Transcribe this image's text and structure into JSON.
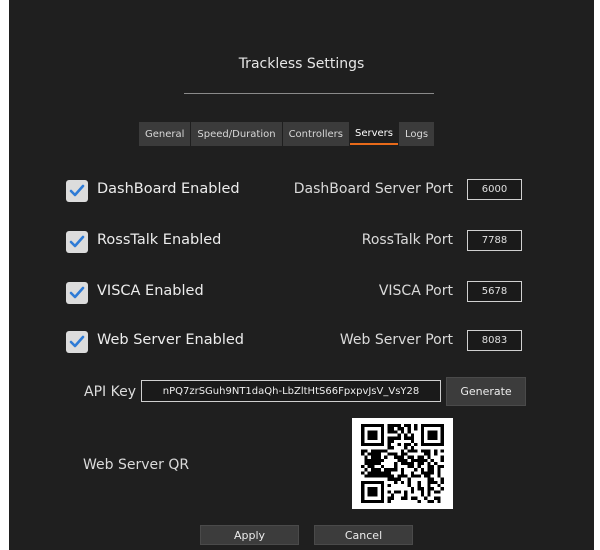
{
  "title": "Trackless Settings",
  "tabs": [
    {
      "label": "General",
      "active": false
    },
    {
      "label": "Speed/Duration",
      "active": false
    },
    {
      "label": "Controllers",
      "active": false
    },
    {
      "label": "Servers",
      "active": true
    },
    {
      "label": "Logs",
      "active": false
    }
  ],
  "servers": [
    {
      "enabled_label": "DashBoard Enabled",
      "checked": true,
      "port_label": "DashBoard Server Port",
      "port": "6000"
    },
    {
      "enabled_label": "RossTalk Enabled",
      "checked": true,
      "port_label": "RossTalk Port",
      "port": "7788"
    },
    {
      "enabled_label": "VISCA Enabled",
      "checked": true,
      "port_label": "VISCA Port",
      "port": "5678"
    },
    {
      "enabled_label": "Web Server Enabled",
      "checked": true,
      "port_label": "Web Server Port",
      "port": "8083"
    }
  ],
  "api": {
    "label": "API Key",
    "value": "nPQ7zrSGuh9NT1daQh-LbZltHtS66FpxpvJsV_VsY28",
    "generate_label": "Generate"
  },
  "qr": {
    "label": "Web Server QR"
  },
  "buttons": {
    "apply": "Apply",
    "cancel": "Cancel"
  },
  "colors": {
    "background": "#1f1f1f",
    "accent": "#e86a1a",
    "checkbox": "#dcdcdc"
  }
}
